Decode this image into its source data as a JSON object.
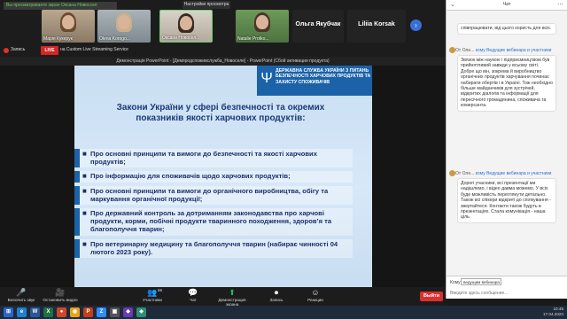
{
  "zoom": {
    "speaker_notice": "Вы просматриваете экран Оксана Новоссел",
    "view_options": "Настройки просмотра",
    "participants": [
      {
        "name": "Марія Кукерук",
        "kind": "video",
        "hair": "#6b4a2e"
      },
      {
        "name": "Olena Korogo...",
        "kind": "video",
        "hair": "#c9b08a"
      },
      {
        "name": "Оксана Новосел...",
        "kind": "video",
        "hair": "#3a2a20"
      },
      {
        "name": "Natalie Protko...",
        "kind": "video",
        "hair": "#4a3626"
      },
      {
        "name": "Ольга Якубчак",
        "kind": "name"
      },
      {
        "name": "Liliia Korsak",
        "kind": "name"
      }
    ],
    "next_arrow": "›",
    "record_label": "Запись",
    "live_badge": "LIVE",
    "stream_label": "на Custom Live Streaming Service",
    "ppt_window_title": "Демонстрація PowerPoint - [Демпродспоживслужба_Новоселе] - PowerPoint (Сбой активации продукта)"
  },
  "slide": {
    "agency": "ДЕРЖАВНА СЛУЖБА УКРАЇНИ З ПИТАНЬ БЕЗПЕЧНОСТІ ХАРЧОВИХ ПРОДУКТІВ ТА ЗАХИСТУ СПОЖИВАЧІВ",
    "emblem": "Ψ",
    "title": "Закони України у сфері безпечності та окремих показників якості харчових продуктів:",
    "bullets": [
      "Про основні принципи та вимоги до безпечності та якості харчових продуктів;",
      "Про інформацію для споживачів щодо харчових продуктів;",
      "Про основні принципи та вимоги до органічного виробництва, обігу та маркування органічної продукції;",
      "Про державний контроль за дотриманням законодавства про харчові продукти, корми, побічні продукти тваринного походження, здоров’я та благополуччя тварин;",
      "Про ветеринарну медицину та благополуччя тварин (набирає чинності 04 лютого 2023 року)."
    ]
  },
  "chat": {
    "title": "Чат",
    "first_message": "співпрацювати, від цього користь для всіх.",
    "messages": [
      {
        "from": "От Оле...",
        "to": "кому Ведущие вебинара и участники",
        "text": "Звязок між наукою і підприємництвом був прийнятливий завжди у всьому світі. Добре що він, зокрема й виробництво органічних продуктів харчування починає набирати обертів і в Україні. Тож необхідно більше майданчиків для зустрічей, відкритих діалогів та інформації для пересічного громадянина, споживача та комерсанта."
      },
      {
        "from": "От Оле...",
        "to": "кому Ведущие вебинара и участники",
        "text": "Дорогі учасники, всі презентації ми надішлемо, і відео давма можемо. У всіх буде можливість переглянути детально. Також всі спікери відкриті до спілкування - звертайтеся. Контакти також будуть в презентаціях. Стала комунікація - наша ціль"
      }
    ],
    "to_label": "Кому:",
    "to_value": "ведущим вебинара",
    "input_placeholder": "Введите здесь сообщение..."
  },
  "toolbar": {
    "items": [
      {
        "label": "Включить звук",
        "icon": "🎤",
        "name": "unmute-button"
      },
      {
        "label": "Остановить видео",
        "icon": "🎥",
        "name": "stop-video-button"
      },
      {
        "label": "Участники",
        "icon": "👥",
        "name": "participants-button"
      },
      {
        "label": "Чат",
        "icon": "💬",
        "name": "chat-button"
      },
      {
        "label": "Демонстрация экрана",
        "icon": "⬆",
        "name": "share-screen-button"
      },
      {
        "label": "Запись",
        "icon": "⏺",
        "name": "record-button"
      },
      {
        "label": "Реакции",
        "icon": "☺",
        "name": "reactions-button"
      }
    ],
    "participants_count": "55",
    "exit": "Выйти"
  },
  "taskbar": {
    "time": "10:45",
    "date": "17.04.2023",
    "apps": [
      "⊞",
      "e",
      "W",
      "X",
      "●",
      "◉",
      "P",
      "Z",
      "▣",
      "◆",
      "◈"
    ],
    "app_colors": [
      "#2a66c9",
      "#1f7fd1",
      "#2b5797",
      "#1e7145",
      "#d24726",
      "#e8a317",
      "#c43e1c",
      "#2d8cff",
      "#555",
      "#6a3ab2",
      "#2f8f6f"
    ]
  }
}
